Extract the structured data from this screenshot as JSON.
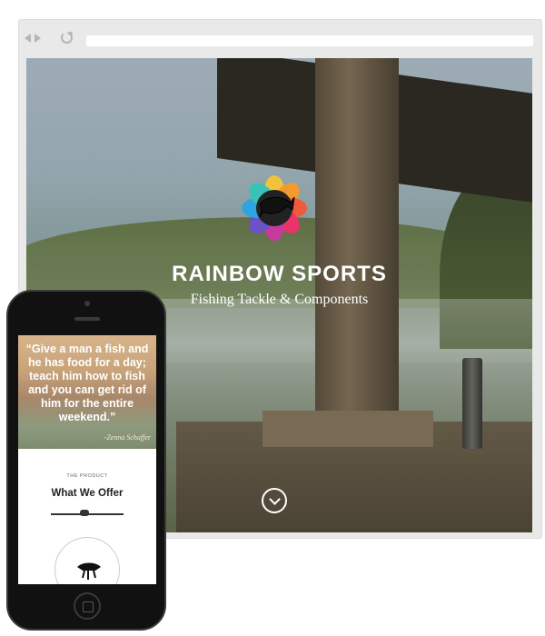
{
  "desktop": {
    "brand": "RAINBOW SPORTS",
    "tagline": "Fishing Tackle & Components",
    "icons": [
      "back-icon",
      "forward-icon",
      "reload-icon",
      "logo-icon",
      "chevron-down-icon"
    ]
  },
  "mobile": {
    "quote": "“Give a man a fish and he has food for a day; teach him how to fish and you can get rid of him for the entire weekend.”",
    "quote_author": "-Zenna Schaffer",
    "kicker": "THE PRODUCT",
    "section_title": "What We Offer",
    "icons": [
      "fishing-rod-icon",
      "lure-icon",
      "home-button-icon"
    ]
  },
  "colors": {
    "browser_chrome": "#e9e9e9",
    "phone_body": "#111111",
    "text_light": "#ffffff"
  }
}
